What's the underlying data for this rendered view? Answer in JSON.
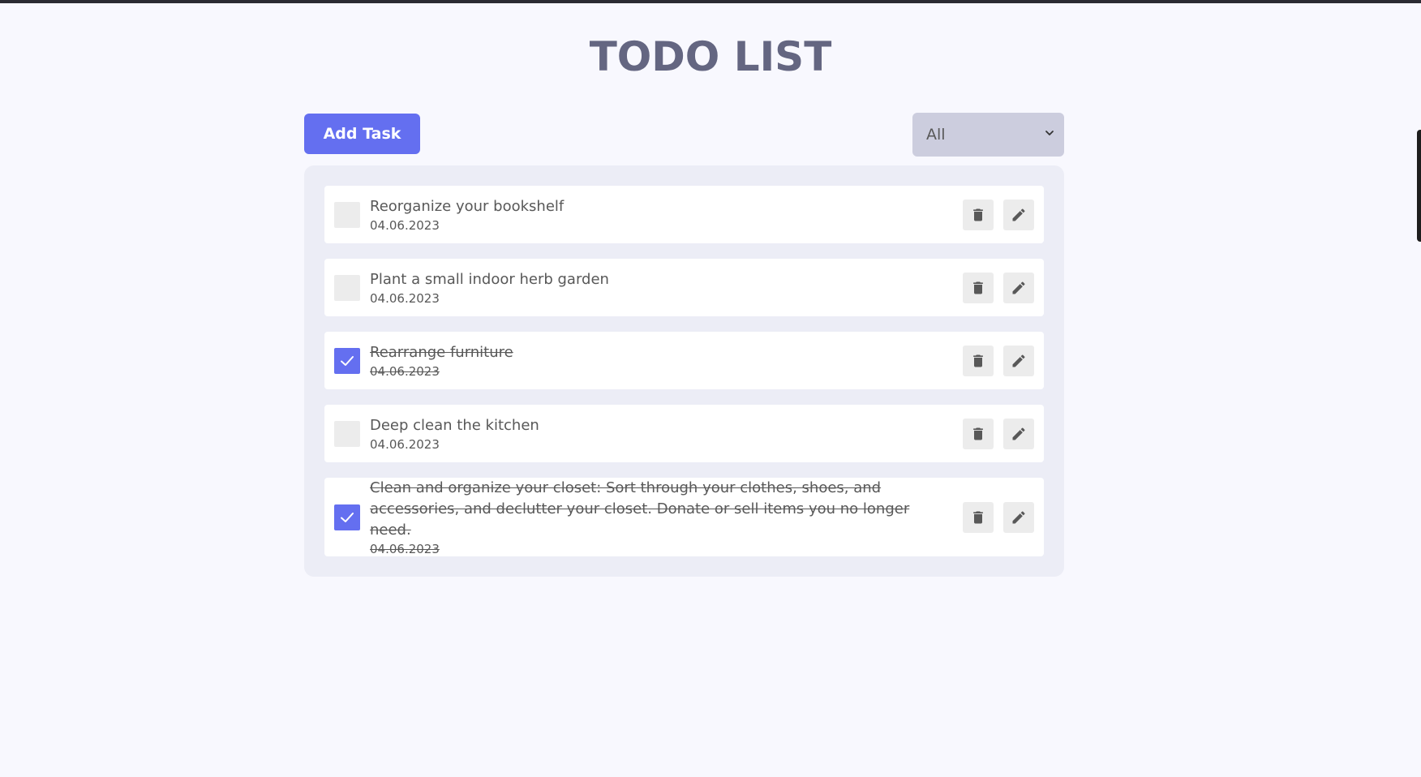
{
  "page": {
    "title": "TODO LIST"
  },
  "toolbar": {
    "add_label": "Add Task",
    "filter": {
      "selected": "All",
      "icon": "chevron-down-icon"
    }
  },
  "tasks": [
    {
      "title": "Reorganize your bookshelf",
      "date": "04.06.2023",
      "completed": false
    },
    {
      "title": "Plant a small indoor herb garden",
      "date": "04.06.2023",
      "completed": false
    },
    {
      "title": "Rearrange furniture",
      "date": "04.06.2023",
      "completed": true
    },
    {
      "title": "Deep clean the kitchen",
      "date": "04.06.2023",
      "completed": false
    },
    {
      "title": "Clean and organize your closet: Sort through your clothes, shoes, and accessories, and declutter your closet. Donate or sell items you no longer need.",
      "date": "04.06.2023",
      "completed": true
    }
  ],
  "icons": {
    "delete": "trash-icon",
    "edit": "pencil-icon",
    "check": "check-icon"
  },
  "colors": {
    "accent": "#646ff0",
    "title": "#646681",
    "background": "#f8f8fe",
    "panel": "#ecedf6",
    "select": "#cccdde"
  }
}
